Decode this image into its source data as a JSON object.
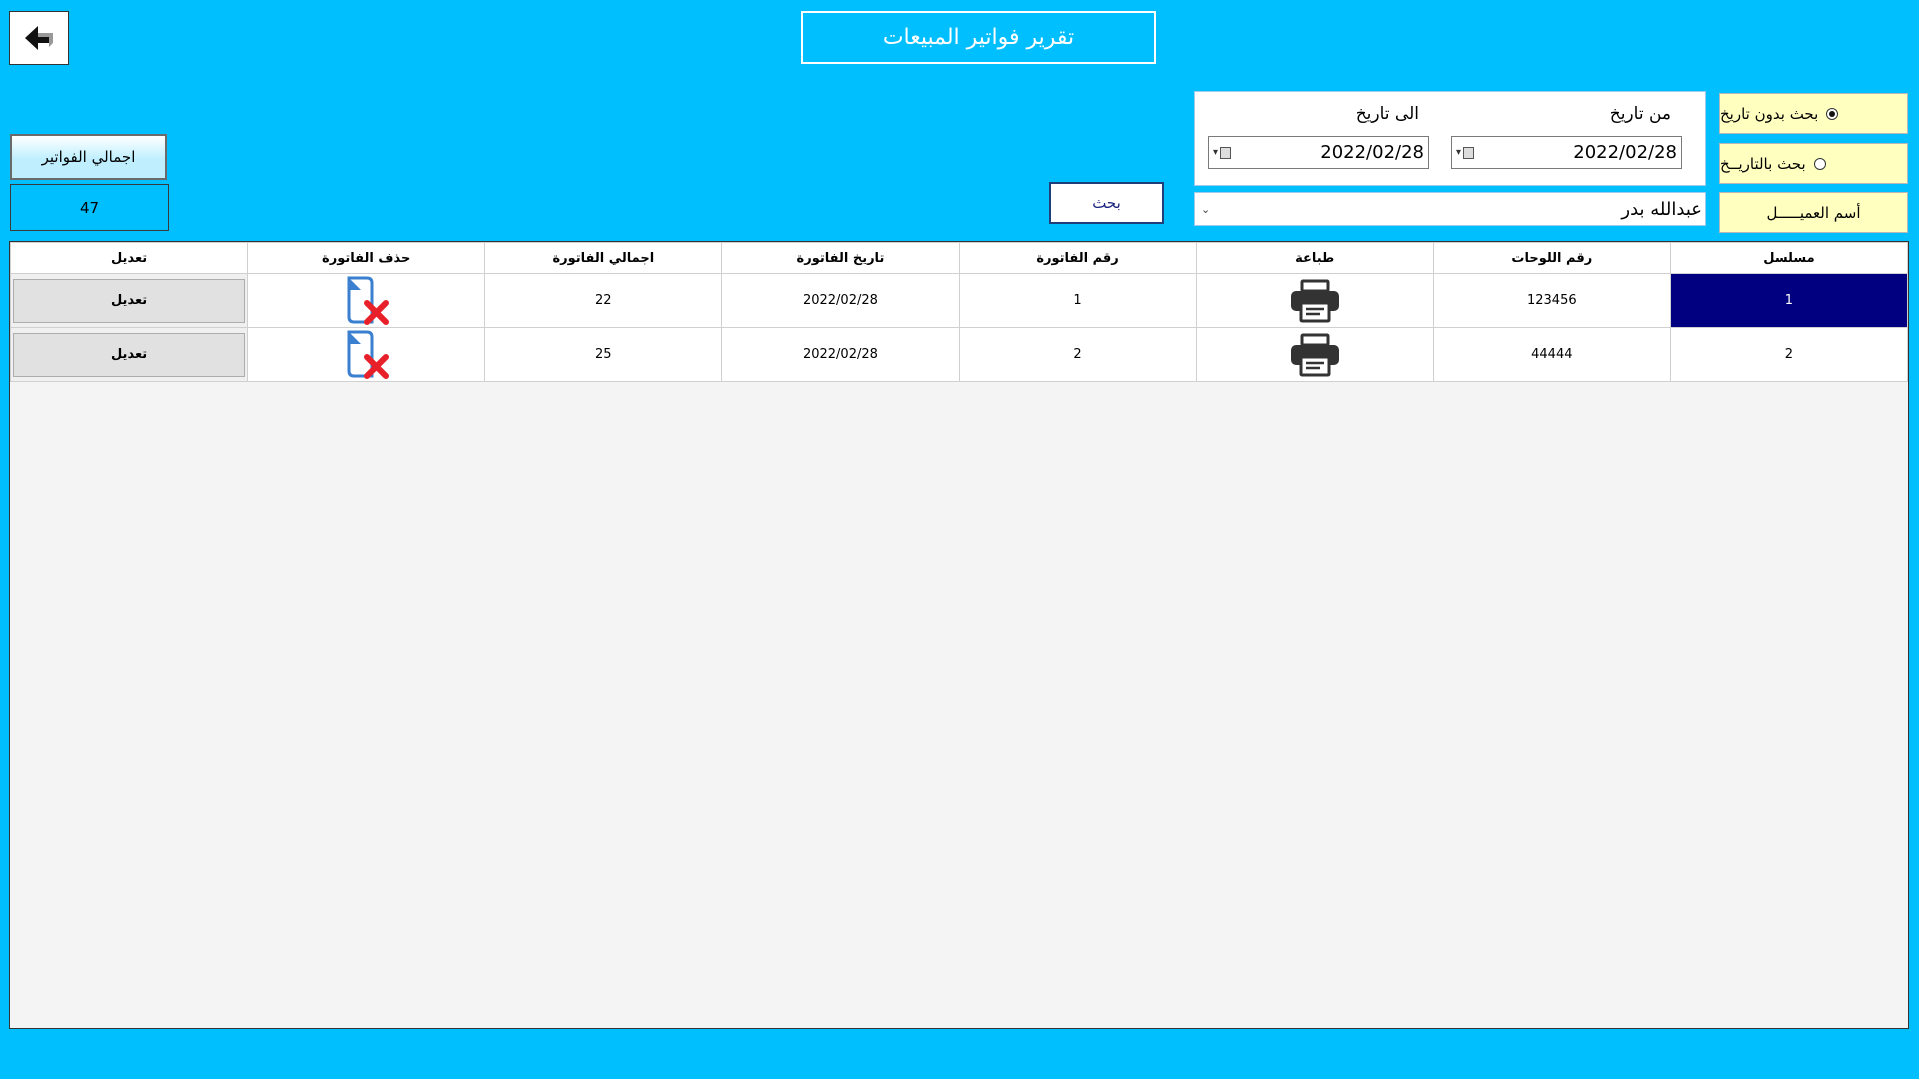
{
  "window": {
    "title": "تقرير فواتير المبيعات"
  },
  "toolbar": {
    "back_icon": "back-arrow-icon"
  },
  "filters": {
    "search_without_date": "بحث بدون تاريخ",
    "search_by_date": "بحث بالتاريــخ",
    "customer_name_label": "أسم العميـــــل",
    "selected_mode": "search_without_date",
    "from_date_label": "من تاريخ",
    "to_date_label": "الى تاريخ",
    "from_date": "2022/02/28",
    "to_date": "2022/02/28",
    "customer_value": "عبدالله بدر",
    "search_button": "بحث"
  },
  "totals": {
    "label": "اجمالي الفواتير",
    "value": "47"
  },
  "table": {
    "columns": [
      "مسلسل",
      "رقم اللوحات",
      "طباعة",
      "رقم الفاتورة",
      "تاريخ الفاتورة",
      "اجمالي الفاتورة",
      "حذف الفاتورة",
      "تعديل"
    ],
    "rows": [
      {
        "serial": "1",
        "plate": "123456",
        "invoice_no": "1",
        "date": "2022/02/28",
        "total": "22",
        "edit": "تعديل"
      },
      {
        "serial": "2",
        "plate": "44444",
        "invoice_no": "2",
        "date": "2022/02/28",
        "total": "25",
        "edit": "تعديل"
      }
    ],
    "selected_row": 0
  },
  "icons": {
    "print": "printer-icon",
    "delete": "delete-document-icon"
  },
  "colors": {
    "background": "#00bfff",
    "selected_row": "#000080",
    "option_panel": "#ffffc0",
    "delete_x": "#e8202a",
    "doc_outline": "#3a7fd0"
  }
}
